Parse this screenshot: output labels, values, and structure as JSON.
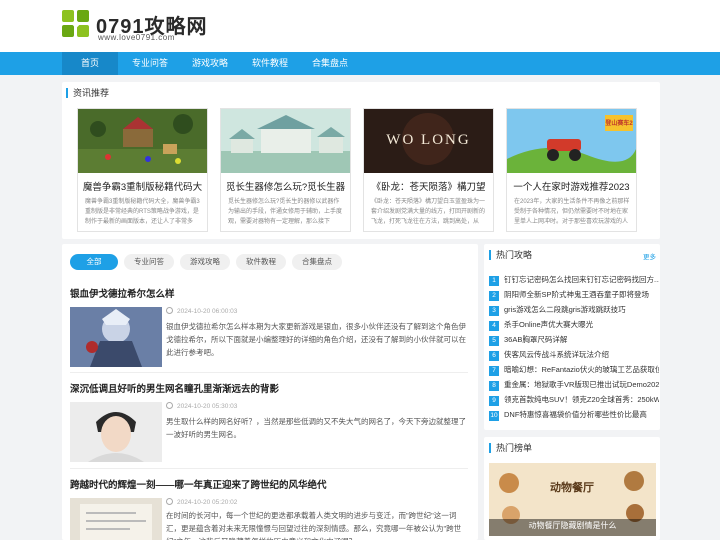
{
  "site": {
    "logo_text": "0791攻略网",
    "logo_url": "www.love0791.com"
  },
  "nav": [
    "首页",
    "专业问答",
    "游戏攻略",
    "软件教程",
    "合集盘点"
  ],
  "recommend": {
    "title": "资讯推荐",
    "items": [
      {
        "title": "魔兽争霸3重制版秘籍代码大",
        "desc": "魔兽争霸3重制版秘籍代码大全，魔兽争霸3重制版是非常经典的RTS策略战争游戏，是制作于最新的画面版本，还让人了非常多"
      },
      {
        "title": "觅长生器修怎么玩?觅长生器",
        "desc": "觅长生器修怎么玩?觅长生的器修以武器作为输出的手段，伴通女修用于辅助，上手度观，需要对器物有一定理解，那么接下"
      },
      {
        "title": "《卧龙：苍天陨落》構刀望",
        "desc": "《卧龙：苍天陨落》構刀望白玉蓝盈珠为一套介绍发剧党满大量的线方，打回开剧新的飞龙，打死飞龙往在方法，跳到高处，从"
      },
      {
        "title": "一个人在家时游戏推荐2023",
        "desc": "在2023年，大家的生活条件不再像之前那样受制于各种情况，但仍然需要时不时地在家里单人上网冲时。对于那些喜欢玩游戏的人"
      }
    ],
    "images": [
      {
        "caption": ""
      },
      {
        "caption": ""
      },
      {
        "caption": "WO LONG"
      },
      {
        "caption": "登山赛车2"
      }
    ]
  },
  "tabs": [
    "全部",
    "专业问答",
    "游戏攻略",
    "软件教程",
    "合集盘点"
  ],
  "articles": [
    {
      "title": "银血伊戈德拉希尔怎么样",
      "date": "2024-10-20 06:00:03",
      "desc": "银血伊戈德拉希尔怎么样本期为大家更新游戏是银血，很多小伙伴还没有了解到这个角色伊戈德拉希尔，所以下面就是小编整理好的详细的角色介绍，还没有了解到的小伙伴就可以在此进行参考吧。"
    },
    {
      "title": "深沉低调且好听的男生网名瞳孔里渐渐远去的背影",
      "date": "2024-10-20 05:30:03",
      "desc": "男生取什么样的网名好听？，当然是那些低调的又不失大气的网名了，今天下旁边就整理了一波好听的男生网名。"
    },
    {
      "title": "跨越时代的辉煌一刻——哪一年真正迎来了跨世纪的风华绝代",
      "date": "2024-10-20 05:20:02",
      "desc": "在时间的长河中，每一个世纪的更迭都承载着人类文明的进步与变迁，而\"跨世纪\"这一词汇，更是蕴含着对未来无限憧憬与回望过往的深刻情感。那么，究竟哪一年被公认为\"跨世纪\"之年，这背后又隐藏着怎样的历史意义和文化内涵呢？"
    }
  ],
  "hot": {
    "title": "热门攻略",
    "more": "更多",
    "items": [
      {
        "n": "1",
        "text": "钉钉忘记密码怎么找回来钉钉忘记密码找回方..."
      },
      {
        "n": "2",
        "text": "阴阳师全新SP阶式神鬼王酒吞童子即将登场"
      },
      {
        "n": "3",
        "text": "gris游戏怎么二段跳gris游戏跳跃技巧"
      },
      {
        "n": "4",
        "text": "杀手Online声优大赛大曝光"
      },
      {
        "n": "5",
        "text": "36AB胸罩尺码详解"
      },
      {
        "n": "6",
        "text": "侠客风云传战斗系统详玩法介绍"
      },
      {
        "n": "7",
        "text": "暗喻幻想：ReFantazio伏火的玻璃工艺品获取位..."
      },
      {
        "n": "8",
        "text": "重金属：地狱歌手VR版现已推出试玩Demo202..."
      },
      {
        "n": "9",
        "text": "领克首款纯电SUV！领克Z20全球首秀：250kW..."
      },
      {
        "n": "10",
        "text": "DNF特惠惊喜福袋价值分析哪些性价比最高"
      }
    ]
  },
  "ranking": {
    "title": "热门榜单",
    "caption": "动物餐厅隐藏剧情是什么",
    "image_text": "动物餐厅"
  },
  "colors": {
    "accent": "#1ea0e6",
    "nav_active": "#1788c9",
    "logo_green": "#8dc21f"
  }
}
